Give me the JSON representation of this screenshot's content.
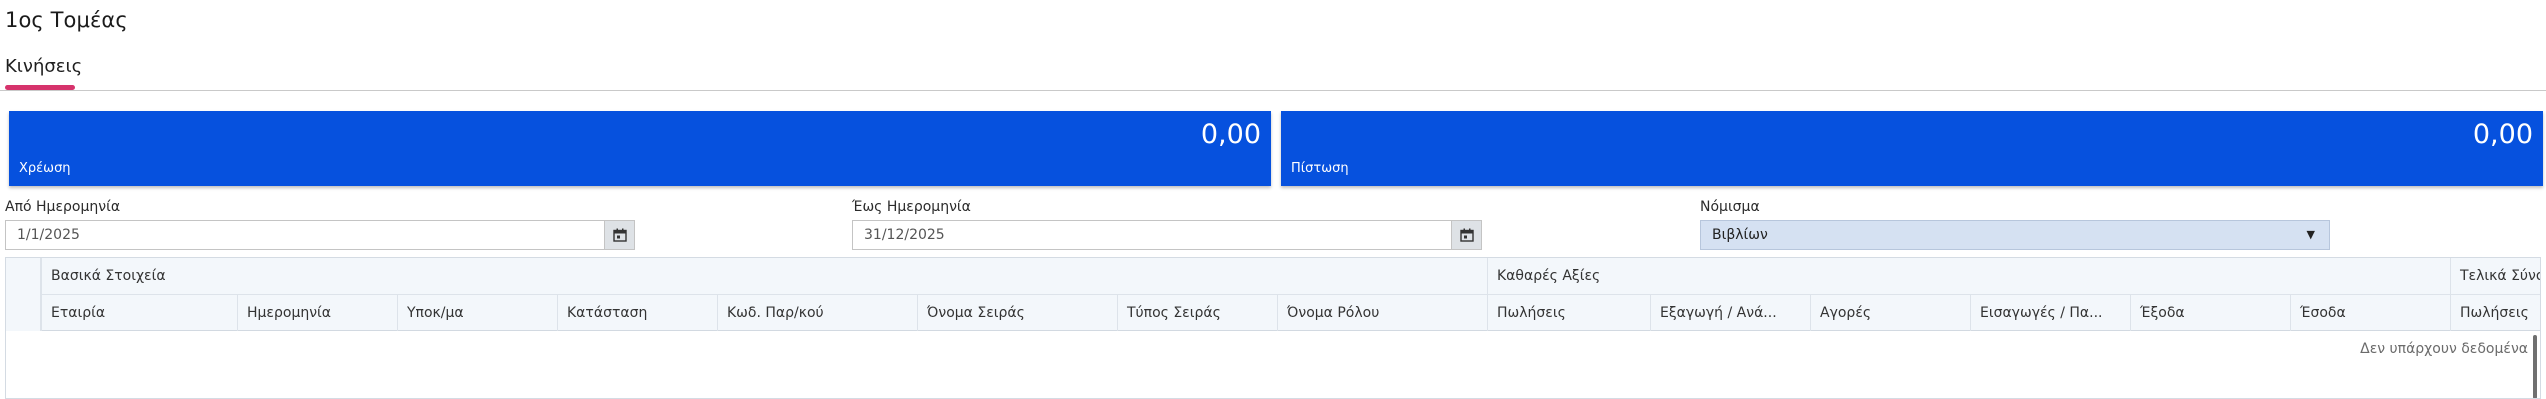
{
  "page": {
    "title": "1ος Τομέας"
  },
  "tabs": [
    {
      "label": "Κινήσεις",
      "active": true
    }
  ],
  "accent_color": "#d6336c",
  "cards": {
    "color": "#0651de",
    "debit": {
      "value": "0,00",
      "label": "Χρέωση"
    },
    "credit": {
      "value": "0,00",
      "label": "Πίστωση"
    }
  },
  "filters": {
    "from_date": {
      "label": "Από Ημερομηνία",
      "value": "1/1/2025",
      "icon": "calendar-icon"
    },
    "to_date": {
      "label": "Έως Ημερομηνία",
      "value": "31/12/2025",
      "icon": "calendar-icon"
    },
    "currency": {
      "label": "Νόμισμα",
      "value": "Βιβλίων",
      "icon": "caret-down-icon"
    }
  },
  "table": {
    "groups": [
      "Βασικά Στοιχεία",
      "Καθαρές Αξίες",
      "Τελικά Σύνολα"
    ],
    "columns": [
      "Εταιρία",
      "Ημερομηνία",
      "Υποκ/μα",
      "Κατάσταση",
      "Κωδ. Παρ/κού",
      "Όνομα Σειράς",
      "Τύπος Σειράς",
      "Όνομα Ρόλου",
      "Πωλήσεις",
      "Εξαγωγή / Ανά...",
      "Αγορές",
      "Εισαγωγές / Πα...",
      "Έξοδα",
      "Έσοδα",
      "Πωλήσεις"
    ],
    "empty_message": "Δεν υπάρχουν δεδομένα"
  }
}
